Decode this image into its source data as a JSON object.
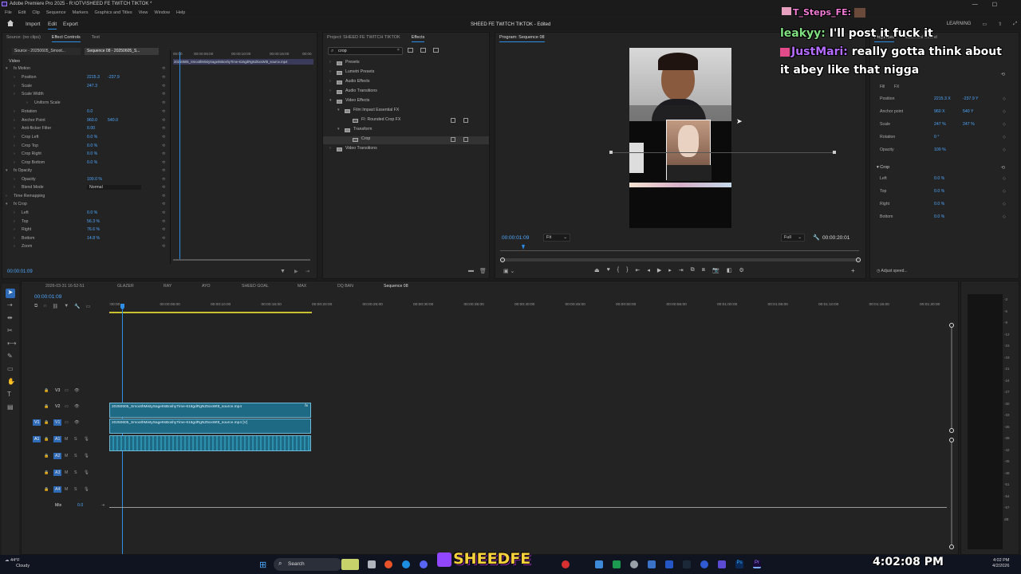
{
  "app_title": "Adobe Premiere Pro 2025 - R:\\OTV\\SHEED FE TWITCH TIKTOK *",
  "menu": [
    "File",
    "Edit",
    "Clip",
    "Sequence",
    "Markers",
    "Graphics and Titles",
    "View",
    "Window",
    "Help"
  ],
  "workspace": {
    "tabs": [
      "Import",
      "Edit",
      "Export"
    ],
    "active": "Edit",
    "center_title": "SHEED FE TWITCH TIKTOK - Edited",
    "right_label": "LEARNING"
  },
  "source_panel": {
    "tabs": [
      "Source: (no clips)",
      "Effect Controls",
      "Text"
    ],
    "active_tab": "Effect Controls",
    "subtabs": [
      "Source - 20250605_Smoot...",
      "Sequence 08 - 20250605_S..."
    ],
    "ruler": [
      "00:00",
      "00:00:05:00",
      "00:00:10:00",
      "00:00:15:00",
      "00:00"
    ],
    "clip_label": "20250605_SmoothMistySageItsBoshyTime-616gdRgNZ5xxWttt_source.mp4",
    "section_video": "Video",
    "rows": [
      {
        "label": "fx Motion",
        "v1": "",
        "v2": ""
      },
      {
        "label": "Position",
        "v1": "2215.3",
        "v2": "-237.9"
      },
      {
        "label": "Scale",
        "v1": "247.3",
        "v2": ""
      },
      {
        "label": "Scale Width",
        "v1": "",
        "v2": ""
      },
      {
        "label": "Uniform Scale",
        "v1": "",
        "v2": ""
      },
      {
        "label": "Rotation",
        "v1": "0.0",
        "v2": ""
      },
      {
        "label": "Anchor Point",
        "v1": "960.0",
        "v2": "540.0"
      },
      {
        "label": "Anti-flicker Filter",
        "v1": "0.00",
        "v2": ""
      },
      {
        "label": "Crop Left",
        "v1": "0.0 %",
        "v2": ""
      },
      {
        "label": "Crop Top",
        "v1": "0.0 %",
        "v2": ""
      },
      {
        "label": "Crop Right",
        "v1": "0.0 %",
        "v2": ""
      },
      {
        "label": "Crop Bottom",
        "v1": "0.0 %",
        "v2": ""
      },
      {
        "label": "fx Opacity",
        "v1": "",
        "v2": ""
      },
      {
        "label": "Opacity",
        "v1": "100.0 %",
        "v2": ""
      },
      {
        "label": "Blend Mode",
        "v1": "Normal",
        "v2": ""
      },
      {
        "label": "Time Remapping",
        "v1": "",
        "v2": ""
      },
      {
        "label": "fx Crop",
        "v1": "",
        "v2": ""
      },
      {
        "label": "Left",
        "v1": "0.0 %",
        "v2": ""
      },
      {
        "label": "Top",
        "v1": "56.3 %",
        "v2": ""
      },
      {
        "label": "Right",
        "v1": "76.6 %",
        "v2": ""
      },
      {
        "label": "Bottom",
        "v1": "14.8 %",
        "v2": ""
      },
      {
        "label": "Zoom",
        "v1": "",
        "v2": ""
      }
    ],
    "timecode": "00:00:01:09"
  },
  "project_panel": {
    "tabs": [
      "Project: SHEED FE TWITCH TIKTOK",
      "Effects"
    ],
    "search_value": "crop",
    "tree": [
      {
        "label": "Presets",
        "depth": 0
      },
      {
        "label": "Lumetri Presets",
        "depth": 0
      },
      {
        "label": "Audio Effects",
        "depth": 0
      },
      {
        "label": "Audio Transitions",
        "depth": 0
      },
      {
        "label": "Video Effects",
        "depth": 0
      },
      {
        "label": "Film Impact Essential FX",
        "depth": 1
      },
      {
        "label": "FI: Rounded Crop FX",
        "depth": 2
      },
      {
        "label": "Transform",
        "depth": 1
      },
      {
        "label": "Crop",
        "depth": 2
      },
      {
        "label": "Video Transitions",
        "depth": 0
      }
    ]
  },
  "program_panel": {
    "title": "Program: Sequence 08",
    "timecode_left": "00:00:01:09",
    "fit": "Fit",
    "full": "Full",
    "timecode_right": "00:00:20:01"
  },
  "properties_panel": {
    "tabs": [
      "Properties",
      "Essential Sound"
    ],
    "fill_label": "Fill",
    "fx_label": "FX",
    "rows": [
      {
        "label": "Position",
        "v1": "2215.3 X",
        "v2": "-237.9 Y"
      },
      {
        "label": "Anchor point",
        "v1": "960 X",
        "v2": "540 Y"
      },
      {
        "label": "Scale",
        "v1": "247 %",
        "v2": "247 %"
      },
      {
        "label": "Rotation",
        "v1": "0 °",
        "v2": ""
      },
      {
        "label": "Opacity",
        "v1": "100 %",
        "v2": ""
      }
    ],
    "crop_section": "Crop",
    "crop_rows": [
      {
        "label": "Left",
        "v1": "0.0 %"
      },
      {
        "label": "Top",
        "v1": "0.0 %"
      },
      {
        "label": "Right",
        "v1": "0.0 %"
      },
      {
        "label": "Bottom",
        "v1": "0.0 %"
      }
    ],
    "adjust_label": "Adjust speed..."
  },
  "timeline": {
    "tabs": [
      "2026-03-31 16-52-51",
      "GLAZER",
      "RAY",
      "AYO",
      "SHEED GOAL",
      "MAX",
      "DQ BAN",
      "Sequence 08"
    ],
    "active_tab": "Sequence 08",
    "timecode": "00:00:01:09",
    "ruler": [
      ":00:00",
      "00:00:05:00",
      "00:00:10:00",
      "00:00:15:00",
      "00:00:20:00",
      "00:00:25:00",
      "00:00:30:00",
      "00:00:35:00",
      "00:00:40:00",
      "00:00:45:00",
      "00:00:50:00",
      "00:00:55:00",
      "00:01:00:00",
      "00:01:05:00",
      "00:01:10:00",
      "00:01:15:00",
      "00:01:20:00"
    ],
    "tracks": [
      "V3",
      "V2",
      "V1",
      "A1",
      "A2",
      "A3",
      "A4",
      "Mix"
    ],
    "mix_value": "0.0",
    "clip_v2": "20250605_SmoothMistySageItsBoshyTime-616gdRgNZ5xxWttt_source.mp4",
    "clip_v1": "20250605_SmoothMistySageItsBoshyTime-616gdRgNZ5xxWttt_source.mp4 [V]"
  },
  "chat": [
    {
      "user": "T_Steps_FE:",
      "msg": ""
    },
    {
      "user": "leakyy:",
      "msg": "I'll post it fuck it"
    },
    {
      "user": "JustMari:",
      "msg": "really gotta think about"
    },
    {
      "user": "",
      "msg": "it abey like that nigga"
    }
  ],
  "overlay_brand": "SHEEDFE",
  "overlay_clock": "4:02:08 PM",
  "taskbar": {
    "weather_temp": "44°F",
    "weather_desc": "Cloudy",
    "search": "Search",
    "time": "4:02 PM",
    "date": "4/2/2026"
  },
  "colors": {
    "accent": "#2e8ee5",
    "clip": "#1e6a84",
    "brand": "#f6d33c",
    "chat_user1": "#7fe07f",
    "chat_user2": "#b36cff"
  }
}
